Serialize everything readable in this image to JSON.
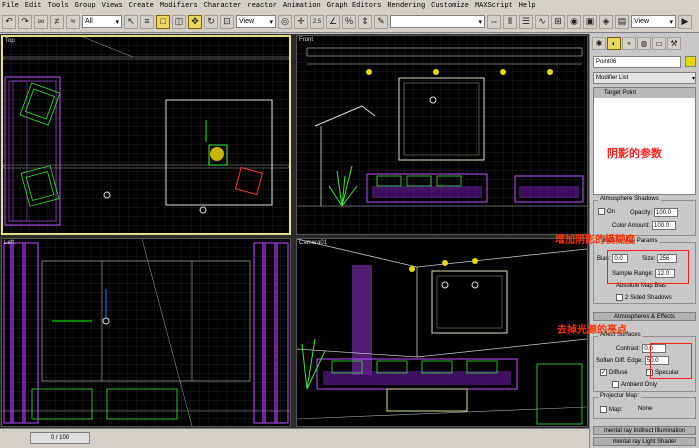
{
  "menu": [
    "File",
    "Edit",
    "Tools",
    "Group",
    "Views",
    "Create",
    "Modifiers",
    "Character",
    "reactor",
    "Animation",
    "Graph Editors",
    "Rendering",
    "Customize",
    "MAXScript",
    "Help"
  ],
  "toolbar": {
    "filter": "All",
    "refsys_left": "View",
    "refsys_right": "View",
    "snap_label": "2.5"
  },
  "viewports": {
    "top": "Top",
    "front": "Front",
    "left": "Left",
    "camera": "Camera01"
  },
  "time": {
    "slider": "0 / 100"
  },
  "panel": {
    "object_name": "Point06",
    "modifier_list": "Modifier List",
    "stack_item": "Target Point",
    "atmos": {
      "title": "Atmosphere Shadows",
      "on": "On",
      "opacity_label": "Opacity:",
      "opacity": "100.0",
      "color_amount_label": "Color Amount:",
      "color_amount": "100.0"
    },
    "shadow_map": {
      "title": "Shadow Map Params",
      "bias_label": "Bias:",
      "bias": "0.0",
      "size_label": "Size:",
      "size": "256",
      "sample_range_label": "Sample Range:",
      "sample_range": "12.0",
      "absolute_bias": "Absolute Map Bias",
      "two_sided": "2 Sided Shadows"
    },
    "atmos_effects": "Atmospheres & Effects",
    "affect": {
      "title": "Affect Surfaces",
      "contrast_label": "Contrast:",
      "contrast": "0.0",
      "soften_label": "Soften Diff. Edge:",
      "soften": "50.0",
      "diffuse": "Diffuse",
      "specular": "Specular",
      "ambient": "Ambient Only"
    },
    "projector": {
      "title": "Projector Map:",
      "map_label": "Map:",
      "map_value": "None"
    },
    "mr_indirect": "mental ray Indirect Illumination",
    "mr_shader": "mental ray Light Shader"
  },
  "annotations": {
    "params": "阴影的参数",
    "blur": "增加阴影的模糊度",
    "remove_highlight": "去掉光源的亮点"
  }
}
